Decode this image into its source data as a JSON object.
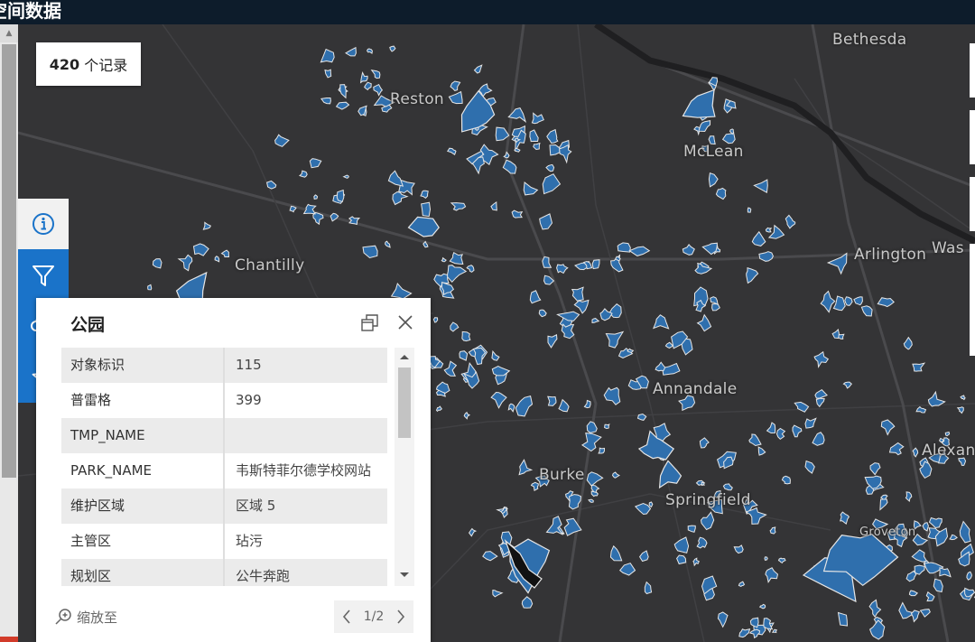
{
  "app": {
    "title": "空间数据"
  },
  "records": {
    "count": "420",
    "unit": "个记录"
  },
  "map": {
    "labels": [
      {
        "text": "Bethesda"
      },
      {
        "text": "Reston"
      },
      {
        "text": "McLean"
      },
      {
        "text": "Chantilly"
      },
      {
        "text": "Arlington"
      },
      {
        "text": "Was"
      },
      {
        "text": "Annandale"
      },
      {
        "text": "Alexan"
      },
      {
        "text": "Burke"
      },
      {
        "text": "Springfield"
      },
      {
        "text": "Groveton"
      }
    ],
    "colors": {
      "base": "#343436",
      "park": "#2f6fad",
      "outline": "#e6e6e6"
    }
  },
  "toolbar": {
    "tools": [
      {
        "name": "info-icon",
        "active": true
      },
      {
        "name": "filter-icon",
        "active": false
      },
      {
        "name": "download-icon",
        "active": false
      },
      {
        "name": "star-icon",
        "active": false
      }
    ]
  },
  "popup": {
    "title": "公园",
    "rows": [
      {
        "key": "对象标识",
        "value": "115"
      },
      {
        "key": "普雷格",
        "value": "399"
      },
      {
        "key": "TMP_NAME",
        "value": ""
      },
      {
        "key": "PARK_NAME",
        "value": "韦斯特菲尔德学校网站"
      },
      {
        "key": "维护区域",
        "value": "区域 5"
      },
      {
        "key": "主管区",
        "value": "玷污"
      },
      {
        "key": "规划区",
        "value": "公牛奔跑"
      }
    ],
    "zoom_label": "缩放至",
    "pager": "1/2"
  }
}
